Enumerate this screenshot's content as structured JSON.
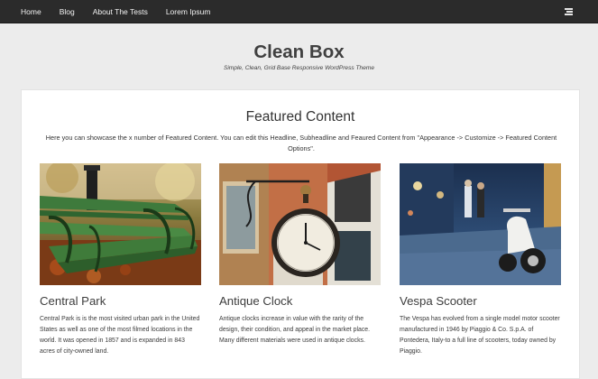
{
  "nav": {
    "items": [
      {
        "label": "Home"
      },
      {
        "label": "Blog"
      },
      {
        "label": "About The Tests"
      },
      {
        "label": "Lorem Ipsum"
      }
    ],
    "menu_icon": "hamburger-icon"
  },
  "site": {
    "title": "Clean Box",
    "description": "Simple, Clean, Grid Base Responsive WordPress Theme"
  },
  "featured": {
    "heading": "Featured Content",
    "subheading": "Here you can showcase the x number of Featured Content. You can edit this Headline, Subheadline and Feaured Content from \"Appearance -> Customize -> Featured Content Options\".",
    "items": [
      {
        "title": "Central Park",
        "text": "Central Park is is the most visited urban park in the United States as well as one of the most filmed locations in the world. It was opened in 1857 and is expanded in 843 acres of city-owned land."
      },
      {
        "title": "Antique Clock",
        "text": "Antique clocks increase in value with the rarity of the design, their condition, and appeal in the market place. Many different materials were used in antique clocks."
      },
      {
        "title": "Vespa Scooter",
        "text": "The Vespa has evolved from a single model motor scooter manufactured in 1946 by Piaggio & Co. S.p.A. of Pontedera, Italy-to a full line of scooters, today owned by Piaggio."
      }
    ]
  }
}
